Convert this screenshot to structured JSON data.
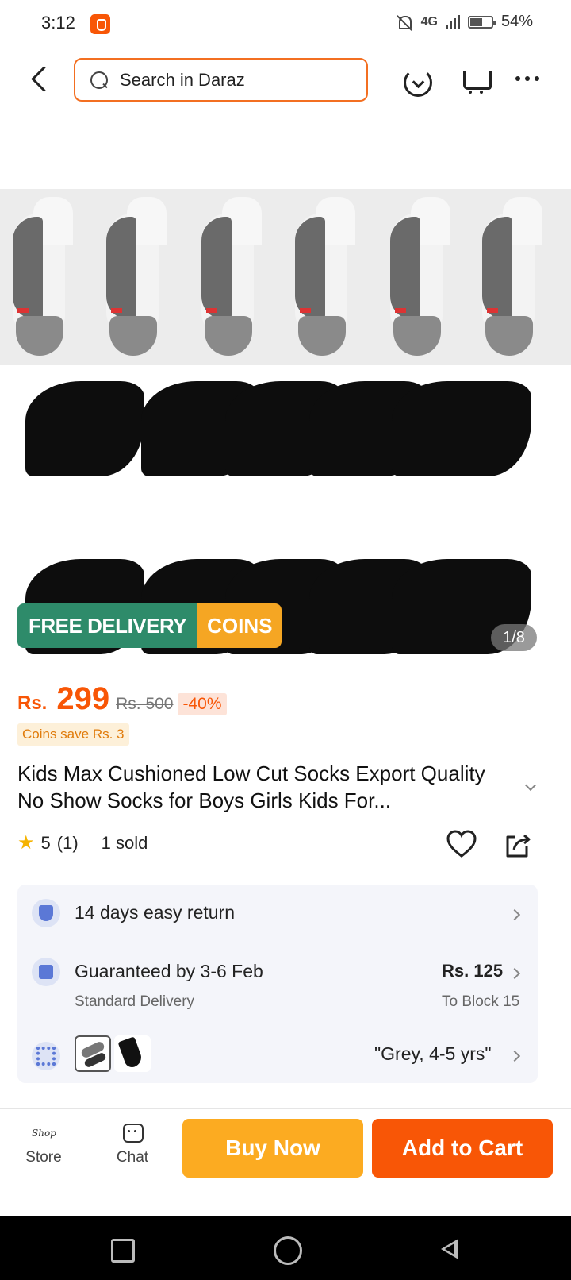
{
  "status_bar": {
    "time": "3:12",
    "network": "4G",
    "battery": "54%"
  },
  "header": {
    "search_placeholder": "Search in Daraz"
  },
  "gallery": {
    "badge_free": "FREE DELIVERY",
    "badge_coins": "COINS",
    "counter": "1/8"
  },
  "price": {
    "currency": "Rs.",
    "value": "299",
    "original": "Rs. 500",
    "discount": "-40%",
    "coins_save": "Coins save Rs. 3"
  },
  "product": {
    "title": "Kids Max Cushioned Low Cut Socks Export Quality No Show Socks for Boys Girls Kids For...",
    "rating": "5",
    "rating_count": "(1)",
    "sold": "1 sold"
  },
  "info": {
    "return_label": "14 days easy return",
    "delivery_label": "Guaranteed by 3-6 Feb",
    "delivery_sub": "Standard Delivery",
    "delivery_price": "Rs. 125",
    "delivery_location": "To Block 15",
    "variant_label": "\"Grey, 4-5 yrs\""
  },
  "bottom_bar": {
    "store_label": "Store",
    "chat_label": "Chat",
    "buy_now": "Buy Now",
    "add_to_cart": "Add to Cart"
  },
  "colors": {
    "brand_orange": "#f85606",
    "buy_yellow": "#fcab21",
    "free_delivery_green": "#2e8b6a",
    "coins_gold": "#f5a623"
  }
}
